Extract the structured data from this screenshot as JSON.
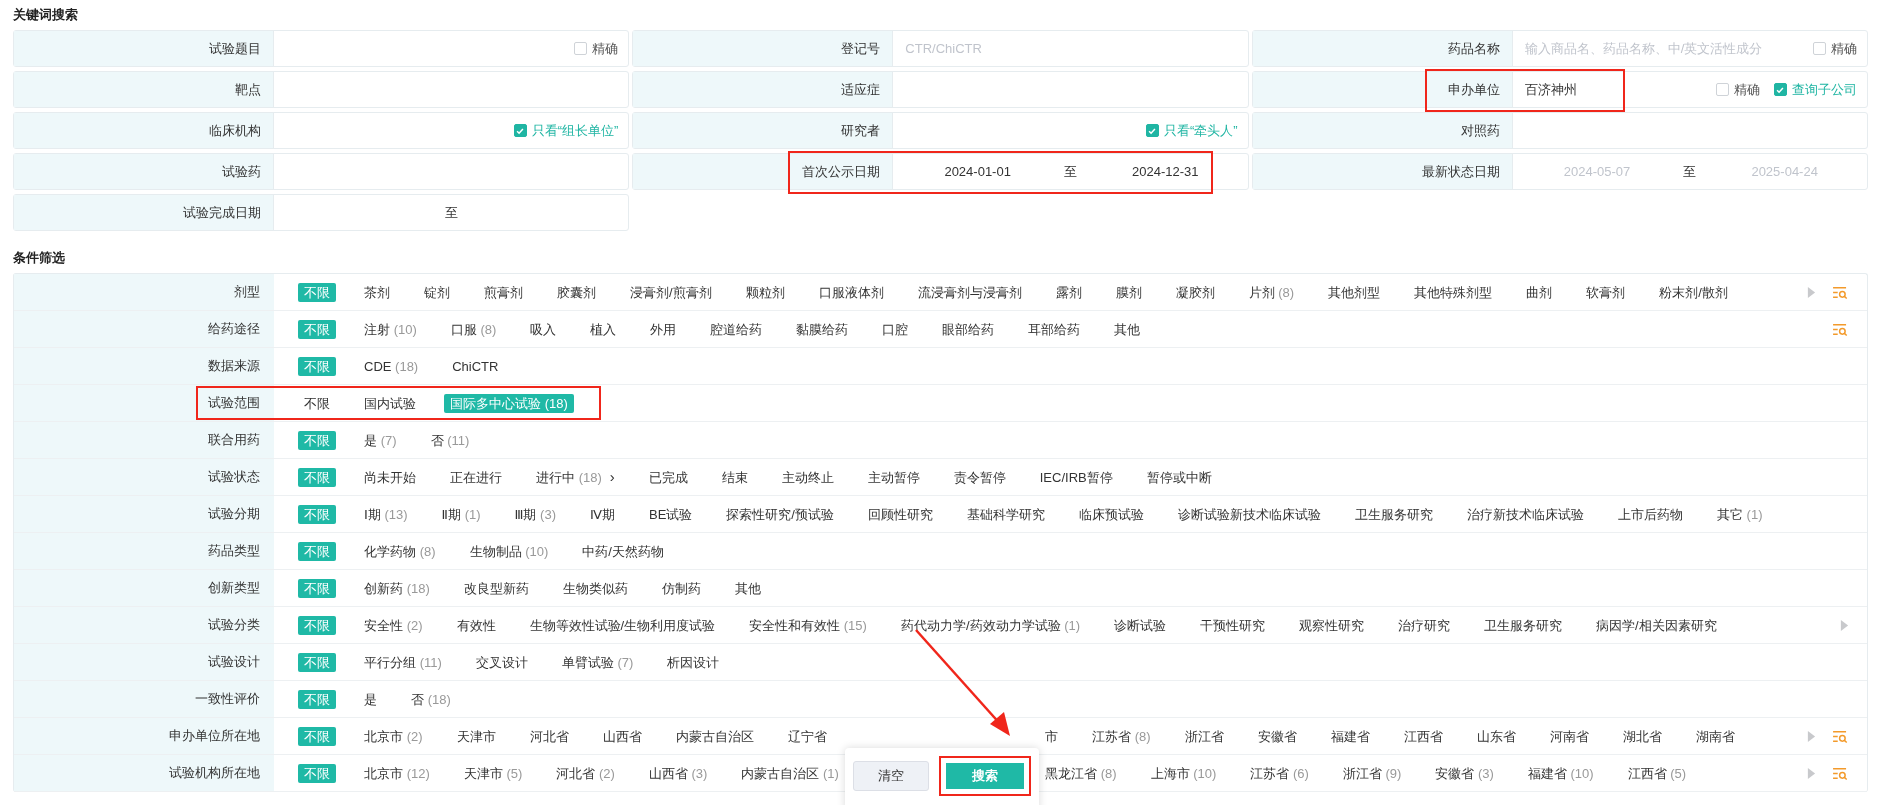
{
  "keyword_section": {
    "title": "关键词搜索"
  },
  "keyword_rows": [
    {
      "fields": [
        {
          "label": "试验题目",
          "kind": "text",
          "highlighted": false,
          "checkboxes": [
            {
              "label": "精确",
              "checked": false
            }
          ]
        },
        {
          "label": "登记号",
          "kind": "text",
          "placeholder": "CTR/ChiCTR",
          "highlighted": false
        },
        {
          "label": "药品名称",
          "kind": "text",
          "placeholder": "输入商品名、药品名称、中/英文活性成分",
          "highlighted": false,
          "checkboxes": [
            {
              "label": "精确",
              "checked": false
            }
          ]
        }
      ]
    },
    {
      "fields": [
        {
          "label": "靶点",
          "kind": "text",
          "highlighted": false
        },
        {
          "label": "适应症",
          "kind": "text",
          "highlighted": false
        },
        {
          "label": "申办单位",
          "kind": "text",
          "value": "百济神州",
          "highlighted": true,
          "checkboxes": [
            {
              "label": "精确",
              "checked": false
            },
            {
              "label": "查询子公司",
              "checked": true
            }
          ]
        }
      ]
    },
    {
      "fields": [
        {
          "label": "临床机构",
          "kind": "text",
          "highlighted": false,
          "checkboxes": [
            {
              "label": "只看“组长单位”",
              "checked": true
            }
          ]
        },
        {
          "label": "研究者",
          "kind": "text",
          "highlighted": false,
          "checkboxes": [
            {
              "label": "只看“牵头人”",
              "checked": true
            }
          ]
        },
        {
          "label": "对照药",
          "kind": "text",
          "highlighted": false
        }
      ]
    },
    {
      "fields": [
        {
          "label": "试验药",
          "kind": "text",
          "highlighted": false
        },
        {
          "label": "首次公示日期",
          "kind": "date_range",
          "from": {
            "value": "2024-01-01"
          },
          "separator": "至",
          "to": {
            "value": "2024-12-31"
          },
          "highlighted": true
        },
        {
          "label": "最新状态日期",
          "kind": "date_range",
          "from": {
            "placeholder": "2024-05-07"
          },
          "separator": "至",
          "to": {
            "placeholder": "2025-04-24"
          },
          "highlighted": false
        }
      ]
    },
    {
      "fields": [
        {
          "label": "试验完成日期",
          "kind": "date_range",
          "separator": "至",
          "highlighted": false
        }
      ]
    }
  ],
  "filter_section": {
    "title": "条件筛选"
  },
  "filters": [
    {
      "label": "剂型",
      "highlighted": false,
      "more_arrow": true,
      "search_icon": true,
      "options": [
        {
          "label": "不限",
          "selected": true
        },
        {
          "label": "茶剂",
          "selected": false
        },
        {
          "label": "锭剂",
          "selected": false
        },
        {
          "label": "煎膏剂",
          "selected": false
        },
        {
          "label": "胶囊剂",
          "selected": false
        },
        {
          "label": "浸膏剂/煎膏剂",
          "selected": false
        },
        {
          "label": "颗粒剂",
          "selected": false
        },
        {
          "label": "口服液体剂",
          "selected": false
        },
        {
          "label": "流浸膏剂与浸膏剂",
          "selected": false
        },
        {
          "label": "露剂",
          "selected": false
        },
        {
          "label": "膜剂",
          "selected": false
        },
        {
          "label": "凝胶剂",
          "selected": false
        },
        {
          "label": "片剂",
          "count": "(8)",
          "selected": false
        },
        {
          "label": "其他剂型",
          "selected": false
        },
        {
          "label": "其他特殊剂型",
          "selected": false
        },
        {
          "label": "曲剂",
          "selected": false
        },
        {
          "label": "软膏剂",
          "selected": false
        },
        {
          "label": "粉末剂/散剂",
          "selected": false
        }
      ]
    },
    {
      "label": "给药途径",
      "highlighted": false,
      "more_arrow": false,
      "search_icon": true,
      "options": [
        {
          "label": "不限",
          "selected": true
        },
        {
          "label": "注射",
          "count": "(10)",
          "selected": false
        },
        {
          "label": "口服",
          "count": "(8)",
          "selected": false
        },
        {
          "label": "吸入",
          "selected": false
        },
        {
          "label": "植入",
          "selected": false
        },
        {
          "label": "外用",
          "selected": false
        },
        {
          "label": "腔道给药",
          "selected": false
        },
        {
          "label": "黏膜给药",
          "selected": false
        },
        {
          "label": "口腔",
          "selected": false
        },
        {
          "label": "眼部给药",
          "selected": false
        },
        {
          "label": "耳部给药",
          "selected": false
        },
        {
          "label": "其他",
          "selected": false
        }
      ]
    },
    {
      "label": "数据来源",
      "highlighted": false,
      "more_arrow": false,
      "search_icon": false,
      "options": [
        {
          "label": "不限",
          "selected": true
        },
        {
          "label": "CDE",
          "count": "(18)",
          "selected": false
        },
        {
          "label": "ChiCTR",
          "selected": false
        }
      ]
    },
    {
      "label": "试验范围",
      "highlighted": true,
      "more_arrow": false,
      "search_icon": false,
      "options": [
        {
          "label": "不限",
          "selected": false
        },
        {
          "label": "国内试验",
          "selected": false
        },
        {
          "label": "国际多中心试验",
          "count": "(18)",
          "selected": true
        }
      ]
    },
    {
      "label": "联合用药",
      "highlighted": false,
      "more_arrow": false,
      "search_icon": false,
      "options": [
        {
          "label": "不限",
          "selected": true
        },
        {
          "label": "是",
          "count": "(7)",
          "selected": false
        },
        {
          "label": "否",
          "count": "(11)",
          "selected": false
        }
      ]
    },
    {
      "label": "试验状态",
      "highlighted": false,
      "more_arrow": false,
      "search_icon": false,
      "options": [
        {
          "label": "不限",
          "selected": true
        },
        {
          "label": "尚未开始",
          "selected": false
        },
        {
          "label": "正在进行",
          "selected": false
        },
        {
          "label": "进行中",
          "count": "(18)",
          "suffix": "›",
          "selected": false
        },
        {
          "label": "已完成",
          "selected": false
        },
        {
          "label": "结束",
          "selected": false
        },
        {
          "label": "主动终止",
          "selected": false
        },
        {
          "label": "主动暂停",
          "selected": false
        },
        {
          "label": "责令暂停",
          "selected": false
        },
        {
          "label": "IEC/IRB暂停",
          "selected": false
        },
        {
          "label": "暂停或中断",
          "selected": false
        }
      ]
    },
    {
      "label": "试验分期",
      "highlighted": false,
      "more_arrow": false,
      "search_icon": false,
      "options": [
        {
          "label": "不限",
          "selected": true
        },
        {
          "label": "Ⅰ期",
          "count": "(13)",
          "selected": false
        },
        {
          "label": "Ⅱ期",
          "count": "(1)",
          "selected": false
        },
        {
          "label": "Ⅲ期",
          "count": "(3)",
          "selected": false
        },
        {
          "label": "Ⅳ期",
          "selected": false
        },
        {
          "label": "BE试验",
          "selected": false
        },
        {
          "label": "探索性研究/预试验",
          "selected": false
        },
        {
          "label": "回顾性研究",
          "selected": false
        },
        {
          "label": "基础科学研究",
          "selected": false
        },
        {
          "label": "临床预试验",
          "selected": false
        },
        {
          "label": "诊断试验新技术临床试验",
          "selected": false
        },
        {
          "label": "卫生服务研究",
          "selected": false
        },
        {
          "label": "治疗新技术临床试验",
          "selected": false
        },
        {
          "label": "上市后药物",
          "selected": false
        },
        {
          "label": "其它",
          "count": "(1)",
          "selected": false
        }
      ]
    },
    {
      "label": "药品类型",
      "highlighted": false,
      "more_arrow": false,
      "search_icon": false,
      "options": [
        {
          "label": "不限",
          "selected": true
        },
        {
          "label": "化学药物",
          "count": "(8)",
          "selected": false
        },
        {
          "label": "生物制品",
          "count": "(10)",
          "selected": false
        },
        {
          "label": "中药/天然药物",
          "selected": false
        }
      ]
    },
    {
      "label": "创新类型",
      "highlighted": false,
      "more_arrow": false,
      "search_icon": false,
      "options": [
        {
          "label": "不限",
          "selected": true
        },
        {
          "label": "创新药",
          "count": "(18)",
          "selected": false
        },
        {
          "label": "改良型新药",
          "selected": false
        },
        {
          "label": "生物类似药",
          "selected": false
        },
        {
          "label": "仿制药",
          "selected": false
        },
        {
          "label": "其他",
          "selected": false
        }
      ]
    },
    {
      "label": "试验分类",
      "highlighted": false,
      "more_arrow": true,
      "search_icon": false,
      "options": [
        {
          "label": "不限",
          "selected": true
        },
        {
          "label": "安全性",
          "count": "(2)",
          "selected": false
        },
        {
          "label": "有效性",
          "selected": false
        },
        {
          "label": "生物等效性试验/生物利用度试验",
          "selected": false
        },
        {
          "label": "安全性和有效性",
          "count": "(15)",
          "selected": false
        },
        {
          "label": "药代动力学/药效动力学试验",
          "count": "(1)",
          "selected": false
        },
        {
          "label": "诊断试验",
          "selected": false
        },
        {
          "label": "干预性研究",
          "selected": false
        },
        {
          "label": "观察性研究",
          "selected": false
        },
        {
          "label": "治疗研究",
          "selected": false
        },
        {
          "label": "卫生服务研究",
          "selected": false
        },
        {
          "label": "病因学/相关因素研究",
          "selected": false
        }
      ]
    },
    {
      "label": "试验设计",
      "highlighted": false,
      "more_arrow": false,
      "search_icon": false,
      "options": [
        {
          "label": "不限",
          "selected": true
        },
        {
          "label": "平行分组",
          "count": "(11)",
          "selected": false
        },
        {
          "label": "交叉设计",
          "selected": false
        },
        {
          "label": "单臂试验",
          "count": "(7)",
          "selected": false
        },
        {
          "label": "析因设计",
          "selected": false
        }
      ]
    },
    {
      "label": "一致性评价",
      "highlighted": false,
      "more_arrow": false,
      "search_icon": false,
      "options": [
        {
          "label": "不限",
          "selected": true
        },
        {
          "label": "是",
          "selected": false
        },
        {
          "label": "否",
          "count": "(18)",
          "selected": false
        }
      ]
    },
    {
      "label": "申办单位所在地",
      "highlighted": false,
      "more_arrow": true,
      "search_icon": true,
      "options": [
        {
          "label": "不限",
          "selected": true
        },
        {
          "label": "北京市",
          "count": "(2)",
          "selected": false
        },
        {
          "label": "天津市",
          "selected": false
        },
        {
          "label": "河北省",
          "selected": false
        },
        {
          "label": "山西省",
          "selected": false
        },
        {
          "label": "内蒙古自治区",
          "selected": false
        },
        {
          "label": "辽宁省",
          "selected": false
        }
      ],
      "options_after_panel": [
        {
          "label": "市",
          "selected": false
        },
        {
          "label": "江苏省",
          "count": "(8)",
          "selected": false
        },
        {
          "label": "浙江省",
          "selected": false
        },
        {
          "label": "安徽省",
          "selected": false
        },
        {
          "label": "福建省",
          "selected": false
        },
        {
          "label": "江西省",
          "selected": false
        },
        {
          "label": "山东省",
          "selected": false
        },
        {
          "label": "河南省",
          "selected": false
        },
        {
          "label": "湖北省",
          "selected": false
        },
        {
          "label": "湖南省",
          "selected": false
        }
      ]
    },
    {
      "label": "试验机构所在地",
      "highlighted": false,
      "more_arrow": true,
      "search_icon": true,
      "options": [
        {
          "label": "不限",
          "selected": true
        },
        {
          "label": "北京市",
          "count": "(12)",
          "selected": false
        },
        {
          "label": "天津市",
          "count": "(5)",
          "selected": false
        },
        {
          "label": "河北省",
          "count": "(2)",
          "selected": false
        },
        {
          "label": "山西省",
          "count": "(3)",
          "selected": false
        },
        {
          "label": "内蒙古自治区",
          "count": "(1)",
          "selected": false
        }
      ],
      "options_after_panel": [
        {
          "label": "黑龙江省",
          "count": "(8)",
          "selected": false
        },
        {
          "label": "上海市",
          "count": "(10)",
          "selected": false
        },
        {
          "label": "江苏省",
          "count": "(6)",
          "selected": false
        },
        {
          "label": "浙江省",
          "count": "(9)",
          "selected": false
        },
        {
          "label": "安徽省",
          "count": "(3)",
          "selected": false
        },
        {
          "label": "福建省",
          "count": "(10)",
          "selected": false
        },
        {
          "label": "江西省",
          "count": "(5)",
          "selected": false
        }
      ]
    }
  ],
  "action_panel": {
    "buttons": [
      {
        "label": "清空",
        "kind": "secondary",
        "highlighted": false
      },
      {
        "label": "搜索",
        "kind": "primary",
        "highlighted": true
      }
    ]
  }
}
